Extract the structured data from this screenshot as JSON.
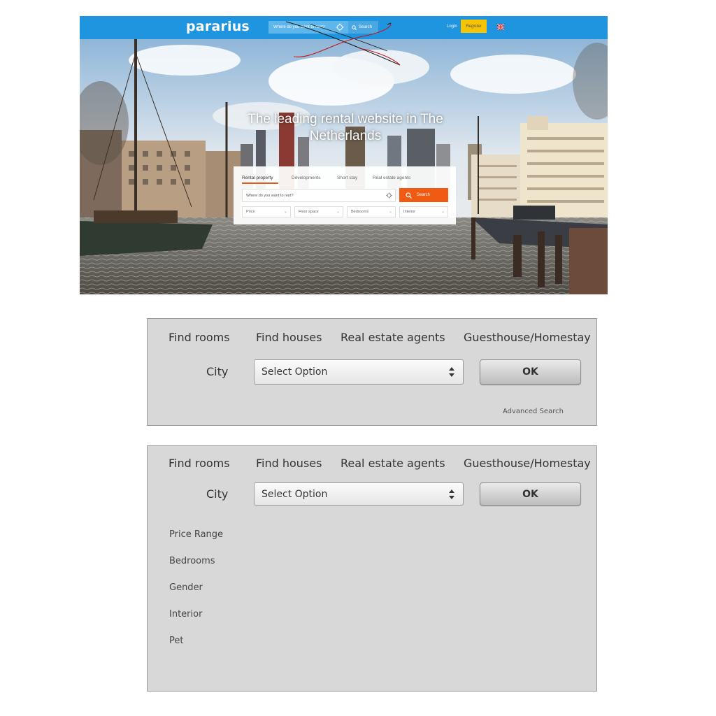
{
  "hero": {
    "logo": "pararius",
    "top_search": {
      "placeholder": "Where do you want to rent?",
      "button_label": "Search"
    },
    "login_label": "Login",
    "register_label": "Register",
    "headline": "The leading rental website in The Netherlands",
    "search_card": {
      "tabs": [
        "Rental property",
        "Developments",
        "Short stay",
        "Real estate agents"
      ],
      "active_tab": "Rental property",
      "input_placeholder": "Where do you want to rent?",
      "search_label": "Search",
      "filters": [
        "Price",
        "Floor space",
        "Bedrooms",
        "Interior"
      ]
    },
    "colors": {
      "topbar": "#1e95de",
      "register": "#f6c400",
      "accent": "#f05a12"
    }
  },
  "panel1": {
    "nav": [
      "Find rooms",
      "Find houses",
      "Real estate agents",
      "Guesthouse/Homestay"
    ],
    "city_label": "City",
    "select_value": "Select Option",
    "ok_label": "OK",
    "advanced_search": "Advanced Search"
  },
  "panel2": {
    "nav": [
      "Find rooms",
      "Find houses",
      "Real estate agents",
      "Guesthouse/Homestay"
    ],
    "city_label": "City",
    "select_value": "Select Option",
    "ok_label": "OK",
    "filters": [
      "Price Range",
      "Bedrooms",
      "Gender",
      "Interior",
      "Pet"
    ]
  }
}
